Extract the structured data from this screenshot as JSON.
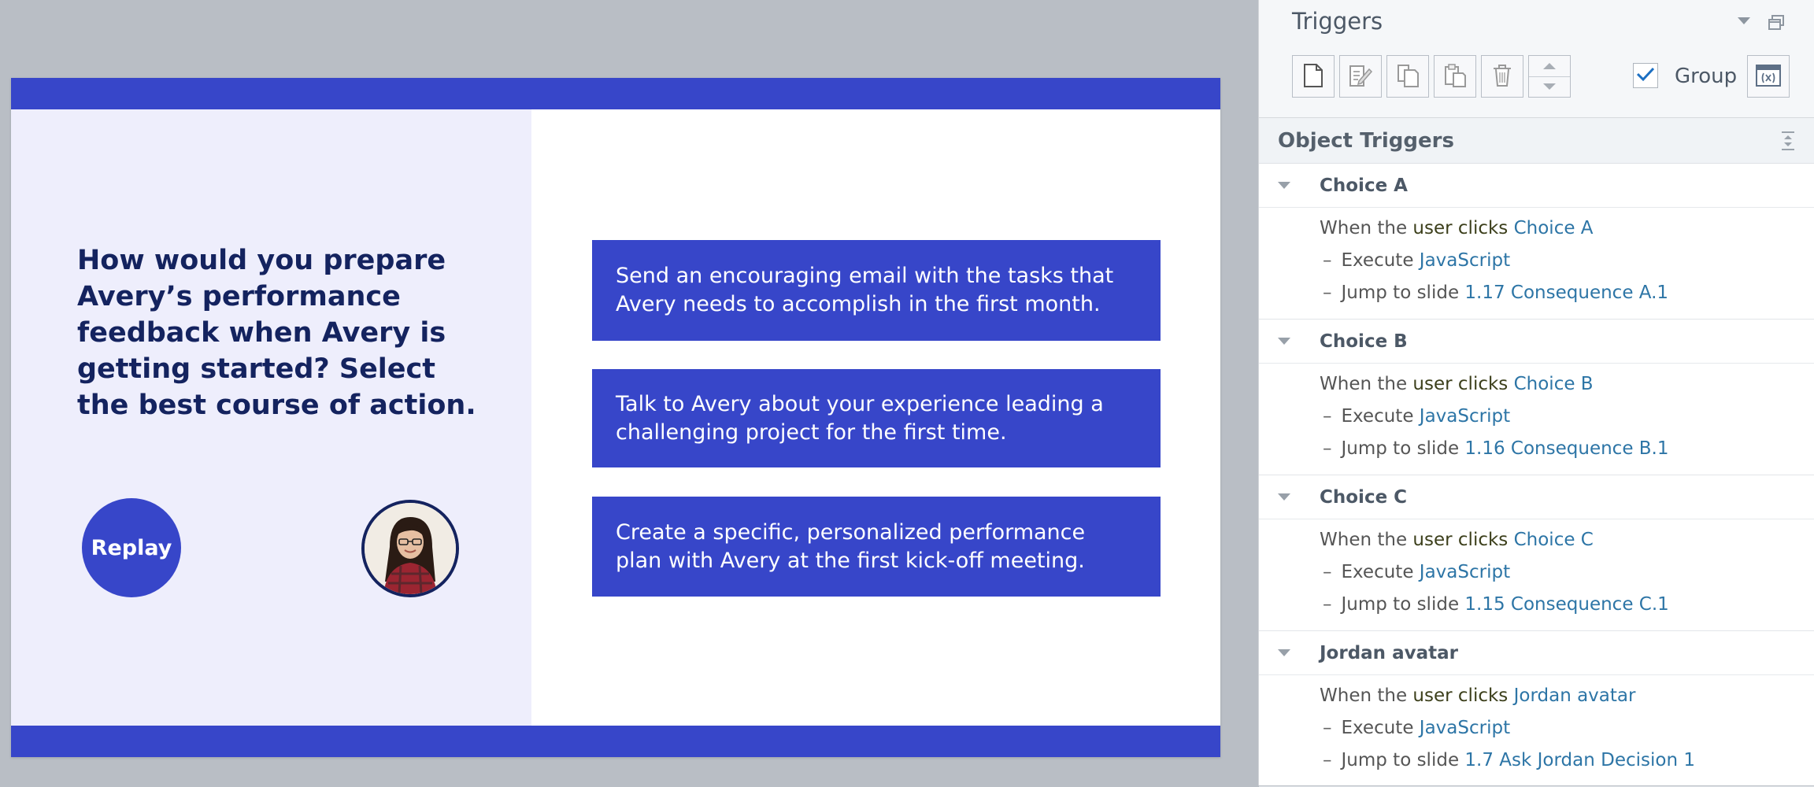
{
  "slide": {
    "question": "How would you prepare Avery’s performance feedback when Avery is getting started? Select the best course of action.",
    "replay_label": "Replay",
    "choices": [
      "Send an encouraging email with the tasks that Avery needs to accomplish in the first month.",
      "Talk to Avery about your experience leading a challenging project for the first time.",
      "Create a specific, personalized performance plan with Avery at the first kick-off meeting."
    ]
  },
  "panel": {
    "title": "Triggers",
    "group_label": "Group",
    "group_checked": true,
    "section_title": "Object Triggers",
    "triggers": [
      {
        "name": "Choice A",
        "when": "When the",
        "user": "user",
        "clicks": "clicks",
        "object": "Choice A",
        "execute": "Execute",
        "execute_target": "JavaScript",
        "jump": "Jump to slide",
        "jump_target": "1.17 Consequence A.1"
      },
      {
        "name": "Choice B",
        "when": "When the",
        "user": "user",
        "clicks": "clicks",
        "object": "Choice B",
        "execute": "Execute",
        "execute_target": "JavaScript",
        "jump": "Jump to slide",
        "jump_target": "1.16 Consequence B.1"
      },
      {
        "name": "Choice C",
        "when": "When the",
        "user": "user",
        "clicks": "clicks",
        "object": "Choice C",
        "execute": "Execute",
        "execute_target": "JavaScript",
        "jump": "Jump to slide",
        "jump_target": "1.15 Consequence C.1"
      },
      {
        "name": "Jordan avatar",
        "when": "When the",
        "user": "user",
        "clicks": "clicks",
        "object": "Jordan avatar",
        "execute": "Execute",
        "execute_target": "JavaScript",
        "jump": "Jump to slide",
        "jump_target": "1.7 Ask Jordan Decision 1"
      }
    ]
  },
  "colors": {
    "brand_blue": "#3746c9",
    "navy_text": "#14235f",
    "left_panel_bg": "#eeeefc",
    "link": "#2d75a6",
    "check": "#1c6fc2"
  },
  "icons": {
    "toolbar": [
      "new-trigger-icon",
      "edit-trigger-icon",
      "copy-icon",
      "paste-icon",
      "delete-icon",
      "move-up-down-icon"
    ],
    "other": [
      "collapse-triangle-icon",
      "restore-window-icon",
      "checkbox-check-icon",
      "variables-icon",
      "collapse-all-icon",
      "avatar-photo"
    ]
  }
}
